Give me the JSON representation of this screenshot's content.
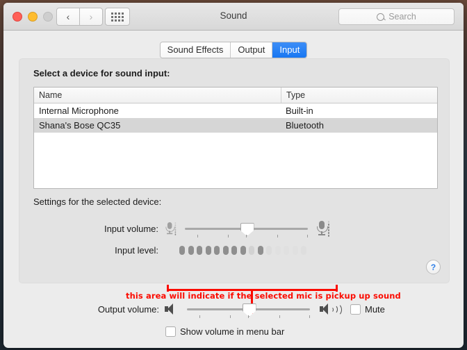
{
  "window": {
    "title": "Sound",
    "traffic_lights": [
      "close",
      "minimize",
      "zoom"
    ],
    "nav_back": "‹",
    "nav_forward": "›",
    "grid_icon": "show-all-icon"
  },
  "search": {
    "placeholder": "Search",
    "value": "",
    "icon": "search-icon"
  },
  "tabs": [
    {
      "label": "Sound Effects",
      "active": false
    },
    {
      "label": "Output",
      "active": false
    },
    {
      "label": "Input",
      "active": true
    }
  ],
  "device_section": {
    "heading": "Select a device for sound input:",
    "columns": [
      "Name",
      "Type"
    ],
    "rows": [
      {
        "name": "Internal Microphone",
        "type": "Built-in",
        "selected": false
      },
      {
        "name": "Shana's Bose QC35",
        "type": "Bluetooth",
        "selected": true
      }
    ]
  },
  "settings": {
    "heading": "Settings for the selected device:",
    "input_volume": {
      "label": "Input volume:",
      "value_pct": 50,
      "left_icon": "microphone-low-icon",
      "right_icon": "microphone-high-icon",
      "tick_count": 5
    },
    "input_level": {
      "label": "Input level:",
      "segments": 15,
      "active_segments": 8,
      "segment_states": [
        "on",
        "on",
        "on",
        "on",
        "on",
        "on",
        "on",
        "on",
        "dim",
        "on",
        "dim",
        "off",
        "off",
        "off",
        "off"
      ]
    }
  },
  "output": {
    "label": "Output volume:",
    "value_pct": 50,
    "tick_count": 5,
    "left_icon": "speaker-mute-icon",
    "right_icon": "speaker-loud-icon",
    "mute": {
      "label": "Mute",
      "checked": false
    },
    "menu_bar": {
      "label": "Show volume in menu bar",
      "checked": false
    }
  },
  "help_button": {
    "label": "?",
    "icon": "help-icon"
  },
  "annotation": {
    "text": "this area will indicate if the selected mic is pickup up sound",
    "color": "#fb0b00",
    "shape": "bracket-with-stem"
  },
  "colors": {
    "accent": "#1877f2",
    "annotation_red": "#fb0b00",
    "window_bg": "#ececec",
    "panel_bg": "#e3e3e3",
    "selected_row": "#d6d6d6"
  }
}
